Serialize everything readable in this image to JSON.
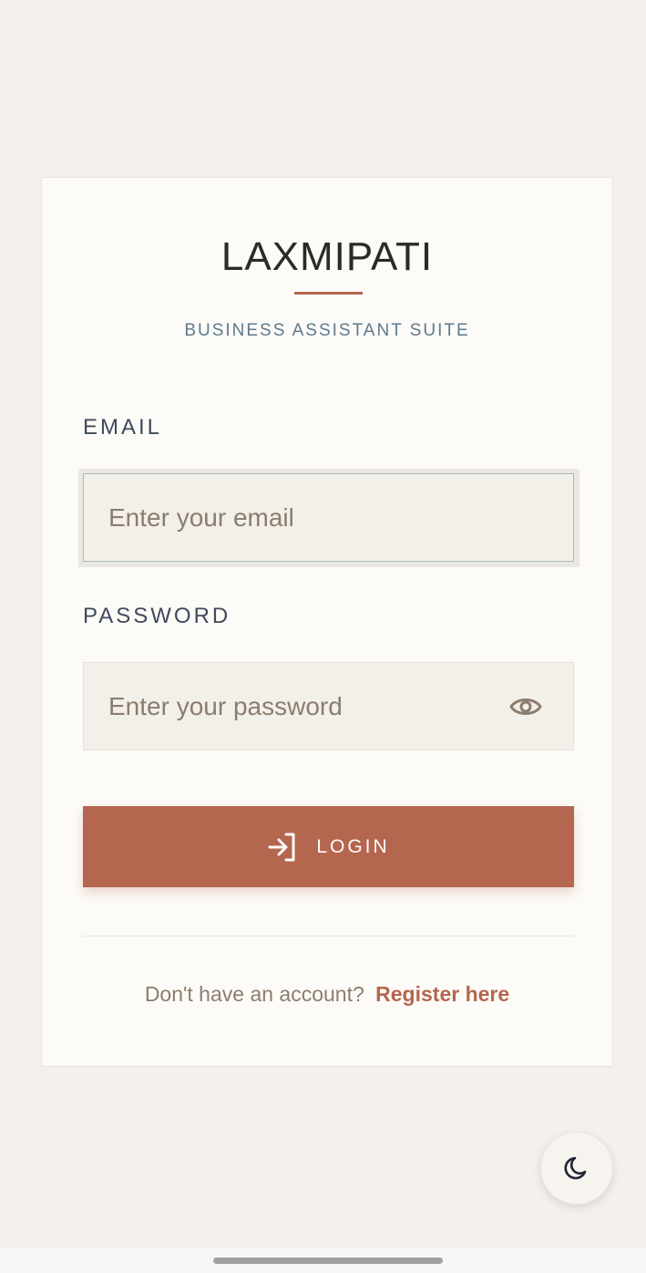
{
  "brand": {
    "title": "LAXMIPATI",
    "tagline": "BUSINESS ASSISTANT SUITE"
  },
  "form": {
    "email_label": "EMAIL",
    "email_placeholder": "Enter your email",
    "email_value": "",
    "password_label": "PASSWORD",
    "password_placeholder": "Enter your password",
    "password_value": "",
    "login_label": "LOGIN"
  },
  "register": {
    "prompt": "Don't have an account?",
    "link_label": "Register here"
  },
  "icons": {
    "password_toggle": "eye-icon",
    "login": "login-icon",
    "theme_toggle": "moon-icon"
  },
  "colors": {
    "background": "#f4f1ec",
    "card": "#fdfbf7",
    "accent": "#b5664f",
    "tagline": "#5d7a8f",
    "label": "#3f4a5c",
    "muted_text": "#8b7d6e"
  }
}
